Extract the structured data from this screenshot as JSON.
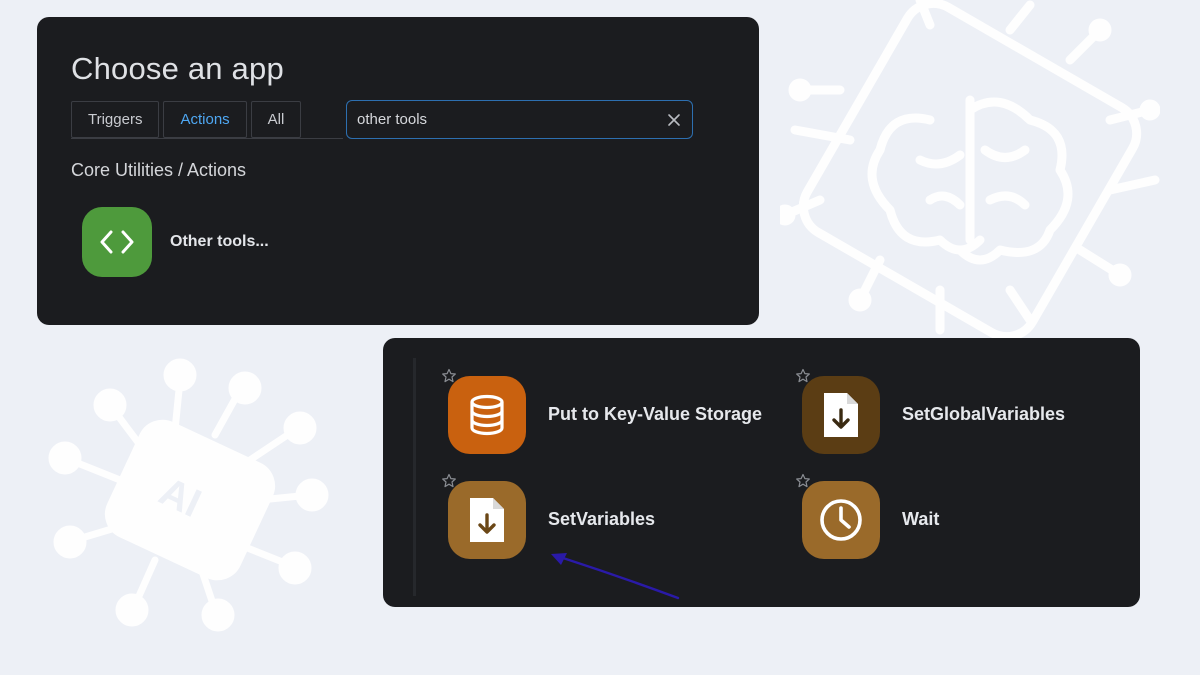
{
  "picker": {
    "title": "Choose an app",
    "tabs": [
      {
        "label": "Triggers",
        "active": false
      },
      {
        "label": "Actions",
        "active": true
      },
      {
        "label": "All",
        "active": false
      }
    ],
    "search": {
      "value": "other tools",
      "clear_icon": "close-icon"
    },
    "section_heading": "Core Utilities / Actions",
    "result": {
      "label": "Other tools...",
      "icon": "code-brackets-icon",
      "color": "#4e9a3c"
    }
  },
  "tools": [
    {
      "label": "Put to Key-Value Storage",
      "icon": "database-icon",
      "color": "#c9610f",
      "star_icon": "star-outline-icon"
    },
    {
      "label": "SetGlobalVariables",
      "icon": "file-download-icon",
      "color": "#5b3d14",
      "star_icon": "star-outline-icon"
    },
    {
      "label": "SetVariables",
      "icon": "file-download-icon",
      "color": "#9a6a2a",
      "star_icon": "star-outline-icon"
    },
    {
      "label": "Wait",
      "icon": "clock-icon",
      "color": "#9a6a2a",
      "star_icon": "star-outline-icon"
    }
  ],
  "accents": {
    "link_blue": "#4ea7f2",
    "panel_bg": "#1b1c1f",
    "page_bg": "#edf0f6",
    "arrow": "#2a1aa8"
  }
}
